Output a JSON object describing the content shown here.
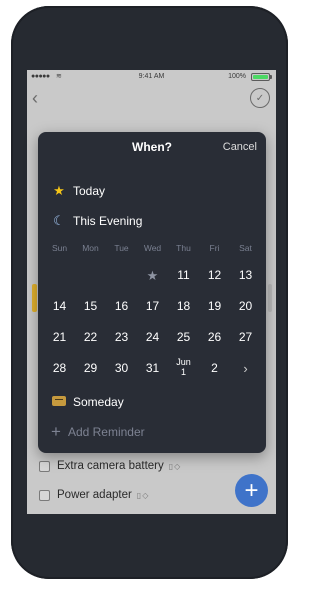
{
  "statusbar": {
    "signal": "●●●●●",
    "wifi": "≋",
    "time": "9:41 AM",
    "battery_pct": "100%"
  },
  "topbar": {
    "back": "‹",
    "complete": "✓"
  },
  "modal": {
    "title": "When?",
    "cancel": "Cancel",
    "today": {
      "icon": "★",
      "label": "Today"
    },
    "evening": {
      "icon": "☾",
      "label": "This Evening"
    },
    "weekdays": [
      "Sun",
      "Mon",
      "Tue",
      "Wed",
      "Thu",
      "Fri",
      "Sat"
    ],
    "weeks": [
      [
        "",
        "",
        "",
        "★",
        "11",
        "12",
        "13"
      ],
      [
        "14",
        "15",
        "16",
        "17",
        "18",
        "19",
        "20"
      ],
      [
        "21",
        "22",
        "23",
        "24",
        "25",
        "26",
        "27"
      ],
      [
        "28",
        "29",
        "30",
        "31",
        "Jun\n1",
        "2",
        "›"
      ]
    ],
    "someday": "Someday",
    "add_reminder": "Add Reminder"
  },
  "items": [
    {
      "label": "Extra camera battery",
      "meta": "▯◇"
    },
    {
      "label": "Power adapter",
      "meta": "▯◇"
    }
  ],
  "fab": "+",
  "colors": {
    "modal_bg": "#292d36",
    "fab": "#3f73c9",
    "star": "#f5c518",
    "accent_yellow": "#e0b02e"
  }
}
